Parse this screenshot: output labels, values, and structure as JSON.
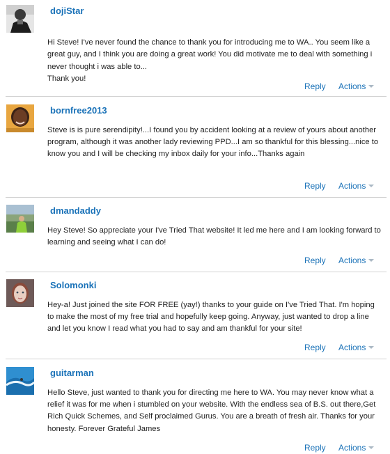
{
  "reply_label": "Reply",
  "actions_label": "Actions",
  "comments": [
    {
      "username": "dojiStar",
      "avatar": "avatar-dojistar",
      "text": "Hi Steve! I've never found the chance to thank you for introducing me to WA.. You seem like a great guy, and I think you are doing a great work! You did motivate me to deal with something i never thought i was able to...\nThank you!"
    },
    {
      "username": "bornfree2013",
      "avatar": "avatar-bornfree2013",
      "text": "Steve is is pure serendipity!...I found you by accident looking at a review of yours about another program, although it was another lady reviewing PPD...I am so thankful for this blessing...nice to know you and I will be checking my inbox daily for your info...Thanks again"
    },
    {
      "username": "dmandaddy",
      "avatar": "avatar-dmandaddy",
      "text": "Hey Steve! So appreciate your I've Tried That website! It led me here and I am looking forward to learning and seeing what I can do!"
    },
    {
      "username": "Solomonki",
      "avatar": "avatar-solomonki",
      "text": "Hey-a! Just joined the site FOR FREE (yay!) thanks to your guide on I've Tried That. I'm hoping to make the most of my free trial and hopefully keep going. Anyway, just wanted to drop a line and let you know I read what you had to say and am thankful for your site!"
    },
    {
      "username": "guitarman",
      "avatar": "avatar-guitarman",
      "text": "Hello Steve, just wanted to thank you for directing me here to WA. You may never know what a relief it was for me when i stumbled on your website. With the endless sea of B.S. out there,Get Rich Quick Schemes, and Self proclaimed Gurus. You are a breath of fresh air. Thanks for your honesty. Forever Grateful James"
    }
  ]
}
